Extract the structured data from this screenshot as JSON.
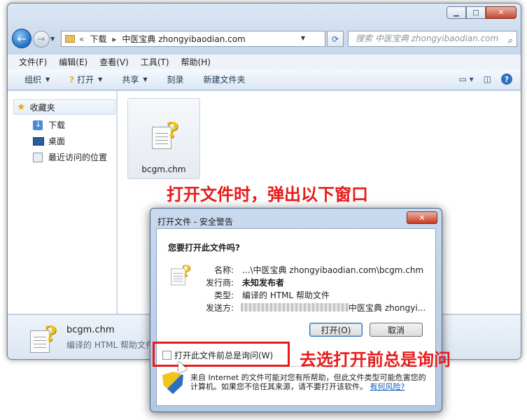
{
  "window": {
    "address": {
      "overflow": "«",
      "parts": [
        "下载",
        "中医宝典 zhongyibaodian.com"
      ]
    },
    "search_placeholder": "搜索 中医宝典 zhongyibaodian.com",
    "menu": [
      "文件(F)",
      "编辑(E)",
      "查看(V)",
      "工具(T)",
      "帮助(H)"
    ],
    "toolbar": {
      "organize": "组织",
      "open": "打开",
      "share": "共享",
      "burn": "刻录",
      "new_folder": "新建文件夹"
    },
    "nav": {
      "favorites": "收藏夹",
      "downloads": "下载",
      "desktop": "桌面",
      "recent": "最近访问的位置"
    },
    "file": {
      "name": "bcgm.chm",
      "type": "编译的 HTML 帮助文件"
    }
  },
  "annotations": {
    "top": "打开文件时，弹出以下窗口",
    "bottom": "去选打开前总是询问"
  },
  "dialog": {
    "title": "打开文件 - 安全警告",
    "question": "您要打开此文件吗?",
    "name_label": "名称:",
    "name_value": "...\\中医宝典 zhongyibaodian.com\\bcgm.chm",
    "publisher_label": "发行商:",
    "publisher_value": "未知发布者",
    "type_label": "类型:",
    "type_value": "编译的 HTML 帮助文件",
    "from_label": "发送方:",
    "from_value": "中医宝典 zhongyi...",
    "open_button": "打开(O)",
    "cancel_button": "取消",
    "checkbox_label": "打开此文件前总是询问(W)",
    "warning_text": "来自 Internet 的文件可能对您有所帮助，但此文件类型可能危害您的计算机。如果您不信任其来源，请不要打开该软件。",
    "risk_link": "有何风险?"
  }
}
